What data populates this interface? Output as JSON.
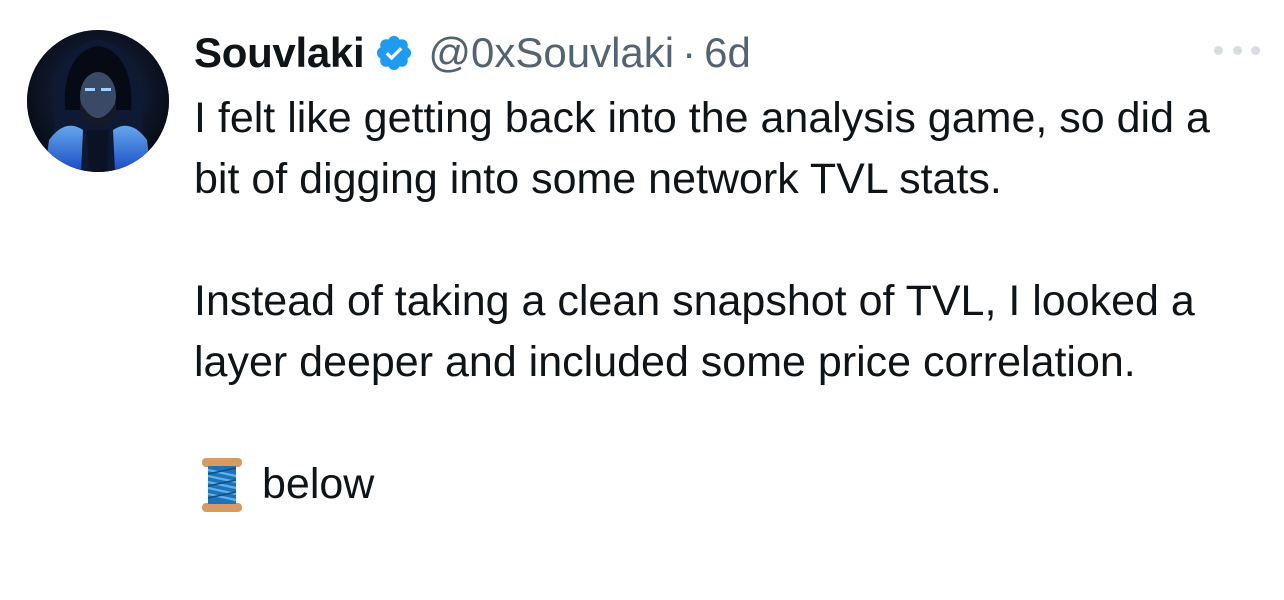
{
  "author": {
    "name": "Souvlaki",
    "handle": "@0xSouvlaki",
    "separator": "·",
    "time": "6d",
    "verified": true,
    "avatar": "hooded-figure-blue-glow"
  },
  "menu": {
    "icon": "more-horizontal-icon"
  },
  "tweet": {
    "line_1": "I felt like getting back into the analysis game, so did a bit of digging into some network TVL stats.",
    "line_2": "Instead of taking a clean snapshot of TVL, I looked a layer deeper and included some price correlation.",
    "thread_emoji": "spool-of-thread",
    "line_3": "below"
  },
  "colors": {
    "text": "#0f1419",
    "secondary": "#536471",
    "verified": "#1d9bf0",
    "menu_dots": "#d8dde1"
  }
}
